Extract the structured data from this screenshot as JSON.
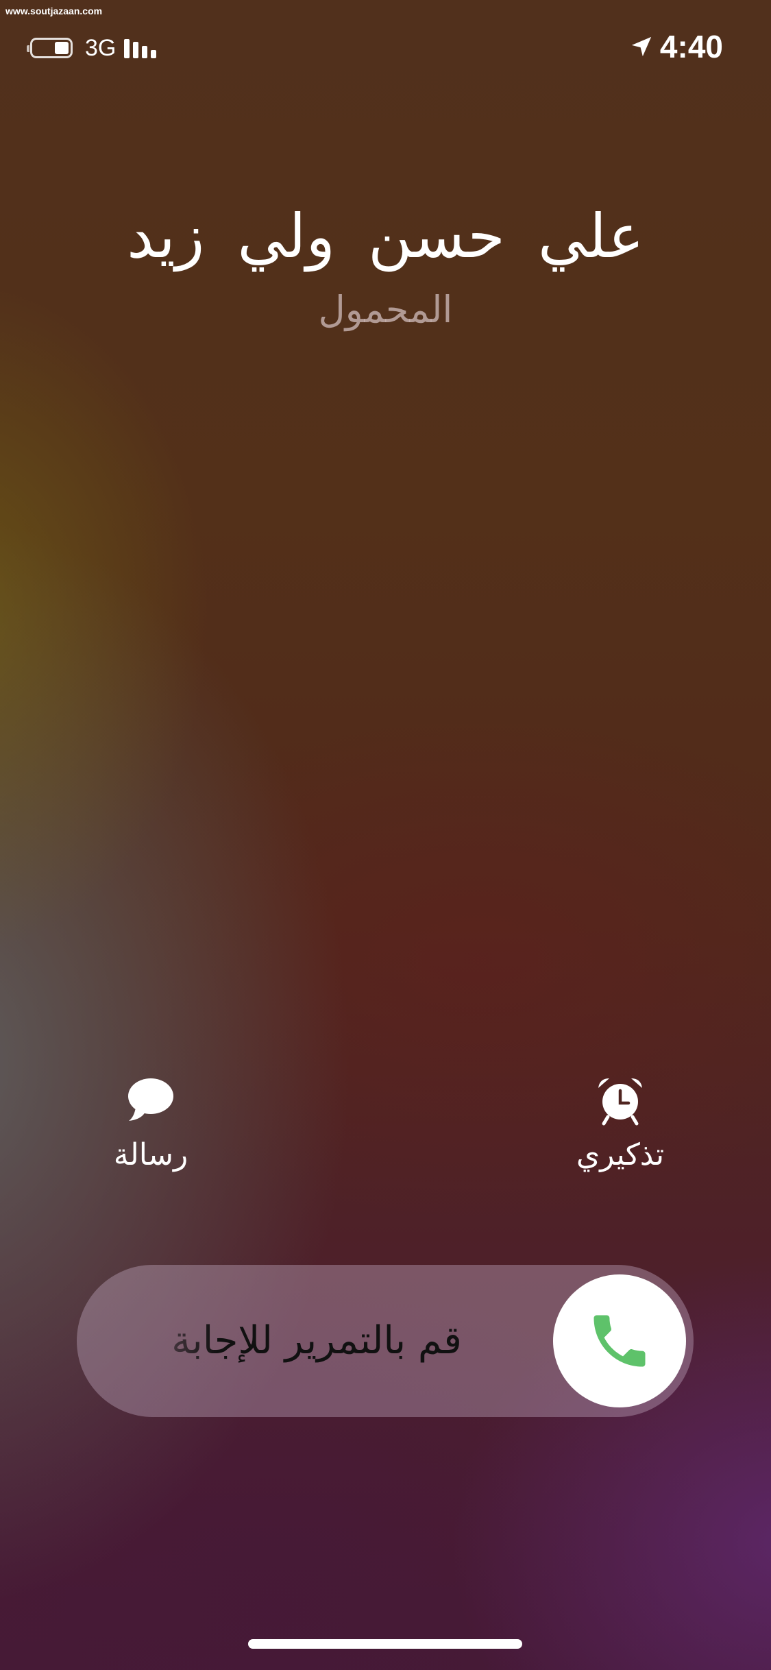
{
  "watermark": "www.soutjazaan.com",
  "status_bar": {
    "network": "3G",
    "time": "4:40",
    "signal_bars": 4,
    "battery_level": 0.4,
    "icons": [
      "battery-icon",
      "signal-icon",
      "location-arrow-icon"
    ]
  },
  "caller": {
    "name": "علي حسن ولي زيد",
    "label": "المحمول"
  },
  "actions": {
    "message": {
      "label": "رسالة",
      "icon": "message-bubble-icon"
    },
    "remind": {
      "label": "تذكيري",
      "icon": "alarm-clock-icon"
    }
  },
  "slider": {
    "text": "قم بالتمرير للإجابة",
    "icon": "phone-icon",
    "icon_color": "#5ec26a"
  }
}
